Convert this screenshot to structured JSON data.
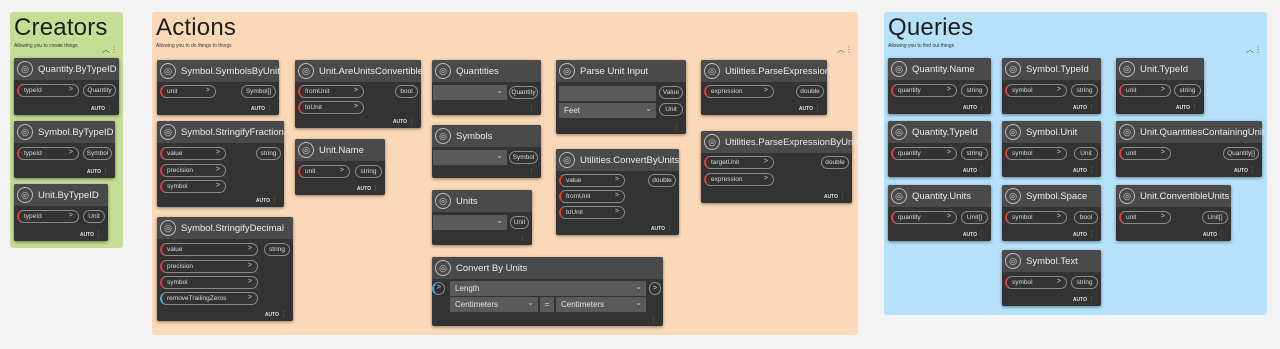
{
  "groups": {
    "creators": {
      "title": "Creators",
      "desc": "Allowing you to create things",
      "color": "#c6dd95"
    },
    "actions": {
      "title": "Actions",
      "desc": "Allowing you to do things to things",
      "color": "#fbd9b8"
    },
    "queries": {
      "title": "Queries",
      "desc": "Allowing you to find out things",
      "color": "#b5e1fb"
    }
  },
  "nodes": {
    "qbytypeid": {
      "title": "Quantity.ByTypeID",
      "in": [
        "typeId"
      ],
      "out": "Quantity",
      "auto": "AUTO"
    },
    "sbytypeid": {
      "title": "Symbol.ByTypeID",
      "in": [
        "typeId"
      ],
      "out": "Symbol",
      "auto": "AUTO"
    },
    "ubytypeid": {
      "title": "Unit.ByTypeID",
      "in": [
        "typeId"
      ],
      "out": "Unit",
      "auto": "AUTO"
    },
    "ssymbolsbyunit": {
      "title": "Symbol.SymbolsByUnit",
      "in": [
        "unit"
      ],
      "out": "Symbol[]",
      "auto": "AUTO"
    },
    "sstringifyfraction": {
      "title": "Symbol.StringifyFraction",
      "in": [
        "value",
        "precision",
        "symbol"
      ],
      "out": "string",
      "auto": "AUTO"
    },
    "sstringifydecimal": {
      "title": "Symbol.StringifyDecimal",
      "in": [
        "value",
        "precision",
        "symbol",
        "removeTrailingZeros"
      ],
      "out": "string",
      "auto": "AUTO"
    },
    "uareunitsconvertible": {
      "title": "Unit.AreUnitsConvertible",
      "in": [
        "fromUnit",
        "toUnit"
      ],
      "out": "bool",
      "auto": "AUTO"
    },
    "uname": {
      "title": "Unit.Name",
      "in": [
        "unit"
      ],
      "out": "string",
      "auto": "AUTO"
    },
    "quantities": {
      "title": "Quantities",
      "out": "Quantity"
    },
    "symbols": {
      "title": "Symbols",
      "out": "Symbol"
    },
    "units": {
      "title": "Units",
      "out": "Unit"
    },
    "parseunitinput": {
      "title": "Parse Unit Input",
      "out1": "Value",
      "out2": "Unit",
      "dropdown": "Feet"
    },
    "convertbyunits": {
      "title": "Utilities.ConvertByUnits",
      "in": [
        "value",
        "fromUnit",
        "toUnit"
      ],
      "out": "double",
      "auto": "AUTO"
    },
    "parseexpression": {
      "title": "Utilities.ParseExpression",
      "in": [
        "expression"
      ],
      "out": "double",
      "auto": "AUTO"
    },
    "parseexpressionbyunit": {
      "title": "Utilities.ParseExpressionByUnit",
      "in": [
        "targetUnit",
        "expression"
      ],
      "out": "double",
      "auto": "AUTO"
    },
    "convertbyunitsui": {
      "title": "Convert By Units",
      "quantity": "Length",
      "from": "Centimeters",
      "to": "Centimeters",
      "eq": "="
    },
    "qname": {
      "title": "Quantity.Name",
      "in": [
        "quantity"
      ],
      "out": "string",
      "auto": "AUTO"
    },
    "qtypeid": {
      "title": "Quantity.TypeId",
      "in": [
        "quantity"
      ],
      "out": "string",
      "auto": "AUTO"
    },
    "qunits": {
      "title": "Quantity.Units",
      "in": [
        "quantity"
      ],
      "out": "Unit[]",
      "auto": "AUTO"
    },
    "stypeid": {
      "title": "Symbol.TypeId",
      "in": [
        "symbol"
      ],
      "out": "string",
      "auto": "AUTO"
    },
    "sunit": {
      "title": "Symbol.Unit",
      "in": [
        "symbol"
      ],
      "out": "Unit",
      "auto": "AUTO"
    },
    "sspace": {
      "title": "Symbol.Space",
      "in": [
        "symbol"
      ],
      "out": "bool",
      "auto": "AUTO"
    },
    "stext": {
      "title": "Symbol.Text",
      "in": [
        "symbol"
      ],
      "out": "string",
      "auto": "AUTO"
    },
    "utypeid": {
      "title": "Unit.TypeId",
      "in": [
        "unit"
      ],
      "out": "string",
      "auto": "AUTO"
    },
    "uquantitiescontaining": {
      "title": "Unit.QuantitiesContainingUnit",
      "in": [
        "unit"
      ],
      "out": "Quantity[]",
      "auto": "AUTO"
    },
    "uconvertibleunits": {
      "title": "Unit.ConvertibleUnits",
      "in": [
        "unit"
      ],
      "out": "Unit[]",
      "auto": "AUTO"
    }
  },
  "icons": {
    "node": "node-glyph-icon",
    "port_arrow": "arrow-right-icon",
    "dropdown": "chevron-down-icon",
    "collapse": "chevron-up-icon",
    "menu": "kebab-menu-icon"
  }
}
